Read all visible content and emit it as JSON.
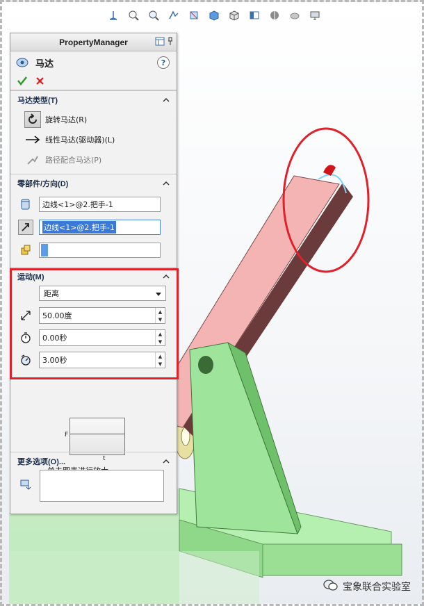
{
  "panel": {
    "title": "PropertyManager",
    "feature_title": "马达",
    "help_label": "?"
  },
  "motor_type": {
    "header": "马达类型(T)",
    "options": [
      {
        "label": "旋转马达(R)",
        "selected": true
      },
      {
        "label": "线性马达(驱动器)(L)",
        "selected": false
      },
      {
        "label": "路径配合马达(P)",
        "selected": false,
        "disabled": true
      }
    ]
  },
  "component_direction": {
    "header": "零部件/方向(D)",
    "location_value": "边线<1>@2.把手-1",
    "direction_value": "边线<1>@2.把手-1",
    "component_value": ""
  },
  "motion": {
    "header": "运动(M)",
    "type_value": "距离",
    "displacement": "50.00度",
    "start_time": "0.00秒",
    "duration": "3.00秒"
  },
  "graph": {
    "y_label": "F",
    "x_label": "t",
    "caption": "单击图表进行放大"
  },
  "more_options": {
    "header": "更多选项(O)..."
  },
  "watermark": {
    "text": "宝象联合实验室"
  },
  "colors": {
    "link": "#f2a7a7",
    "base": "#8fe08f",
    "highlight": "#e0202a",
    "selection": "#3a79d8"
  }
}
